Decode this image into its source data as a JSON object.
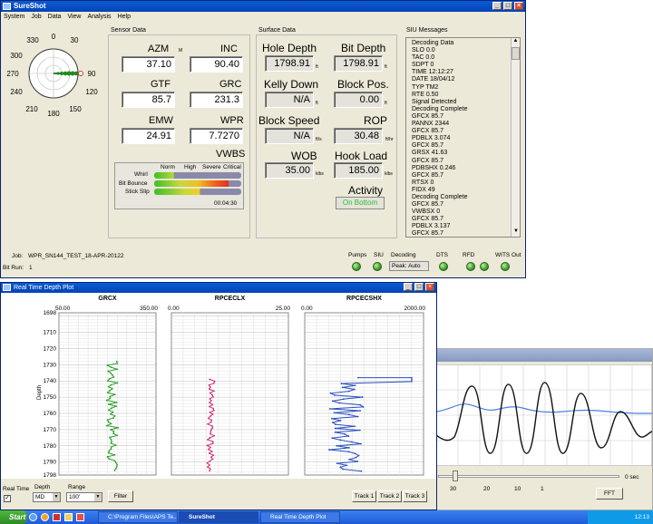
{
  "main": {
    "title": "SureShot",
    "menu": [
      "System",
      "Job",
      "Data",
      "View",
      "Analysis",
      "Help"
    ],
    "compass": {
      "labels": [
        "330",
        "0",
        "30",
        "300",
        "90",
        "270",
        "240",
        "120",
        "210",
        "180",
        "150"
      ]
    },
    "sensor": {
      "title": "Sensor Data",
      "azm_label": "AZM",
      "azm_unit": "M",
      "azm": "37.10",
      "inc_label": "INC",
      "inc": "90.40",
      "gtf_label": "GTF",
      "gtf": "85.7",
      "grc_label": "GRC",
      "grc": "231.3",
      "emw_label": "EMW",
      "emw": "24.91",
      "wpr_label": "WPR",
      "wpr": "7.7270",
      "vwbs_title": "VWBS",
      "vwbs_cols": [
        "Norm",
        "High",
        "Severe",
        "Critical"
      ],
      "vwbs_rows": [
        {
          "label": "Whirl",
          "level": 0.22
        },
        {
          "label": "Bit Bounce",
          "level": 0.85
        },
        {
          "label": "Stick Slip",
          "level": 0.52
        }
      ],
      "vwbs_time": "00:04:30"
    },
    "surface": {
      "title": "Surface Data",
      "hole_depth_label": "Hole Depth",
      "hole_depth": "1798.91",
      "hole_unit": "ft",
      "bit_depth_label": "Bit Depth",
      "bit_depth": "1798.91",
      "bit_unit": "ft",
      "kelly_label": "Kelly Down",
      "kelly": "N/A",
      "kelly_unit": "ft",
      "block_pos_label": "Block Pos.",
      "block_pos": "0.00",
      "block_unit": "ft",
      "block_speed_label": "Block Speed",
      "block_speed": "N/A",
      "speed_unit": "ft/s",
      "rop_label": "ROP",
      "rop": "30.48",
      "rop_unit": "ft/hr",
      "wob_label": "WOB",
      "wob": "35.00",
      "wob_unit": "klbs",
      "hookload_label": "Hook Load",
      "hookload": "185.00",
      "hook_unit": "klbs",
      "activity_label": "Activity",
      "activity": "On Bottom"
    },
    "siu": {
      "title": "SIU Messages",
      "messages": [
        "Decoding Data",
        "SLO   0.0",
        "TAC   0.0",
        "SDPT   0",
        "TIME 12:12:27",
        "DATE 18/04/12",
        "TYP TM2",
        "RTE  0.50",
        "Signal Detected",
        "Decoding Complete",
        "GFCX 85.7",
        "PANNX 2344",
        "GFCX 85.7",
        "PDBLX 3.074",
        "GFCX 85.7",
        "GRSX 41.63",
        "GFCX 85.7",
        "PDBSHX 0.246",
        "GFCX 85.7",
        "RTSX 0",
        "FIDX 49",
        "Decoding Complete",
        "GFCX 85.7",
        "VWBSX 0",
        "GFCX 85.7",
        "PDBLX 3.137",
        "GFCX 85.7"
      ]
    },
    "footer": {
      "job_label": "Job:",
      "job": "WPR_SN144_TEST_18-APR-20122",
      "bitrun_label": "Bit Run:",
      "bitrun": "1",
      "pumps": "Pumps",
      "siu": "SIU",
      "decoding": "Decoding",
      "decoding_val": "Peak: Auto",
      "dts": "DTS",
      "rfd": "RFD",
      "wits": "WITS Out"
    }
  },
  "depth_plot": {
    "title": "Real Time Depth Plot",
    "depth_axis_label": "Depth",
    "depth_ticks": [
      "1698",
      "1710",
      "1720",
      "1730",
      "1740",
      "1750",
      "1760",
      "1770",
      "1780",
      "1790",
      "1798"
    ],
    "tracks": [
      {
        "name": "GRCX",
        "min": "50.00",
        "max": "350.00",
        "color": "#2aa02a"
      },
      {
        "name": "RPCECLX",
        "min": "0.00",
        "max": "25.00",
        "color": "#d0307a"
      },
      {
        "name": "RPCECSHX",
        "min": "0.00",
        "max": "2000.00",
        "color": "#2a4fbf"
      }
    ],
    "realtime_label": "Real Time",
    "depth_label": "Depth",
    "depth_select": "MD",
    "range_label": "Range",
    "range_select": "100'",
    "filter_btn": "Filter",
    "track1_btn": "Track 1",
    "track2_btn": "Track 2",
    "track3_btn": "Track 3"
  },
  "waveform": {
    "x_ticks": [
      "30",
      "20",
      "10",
      "1"
    ],
    "sec_label": "0  sec",
    "fft_btn": "FFT"
  },
  "taskbar": {
    "start": "Start",
    "tasks": [
      "C:\\Program Files\\APS Te...",
      "SureShot",
      "Real Time Depth Plot"
    ],
    "clock": "12:13"
  }
}
